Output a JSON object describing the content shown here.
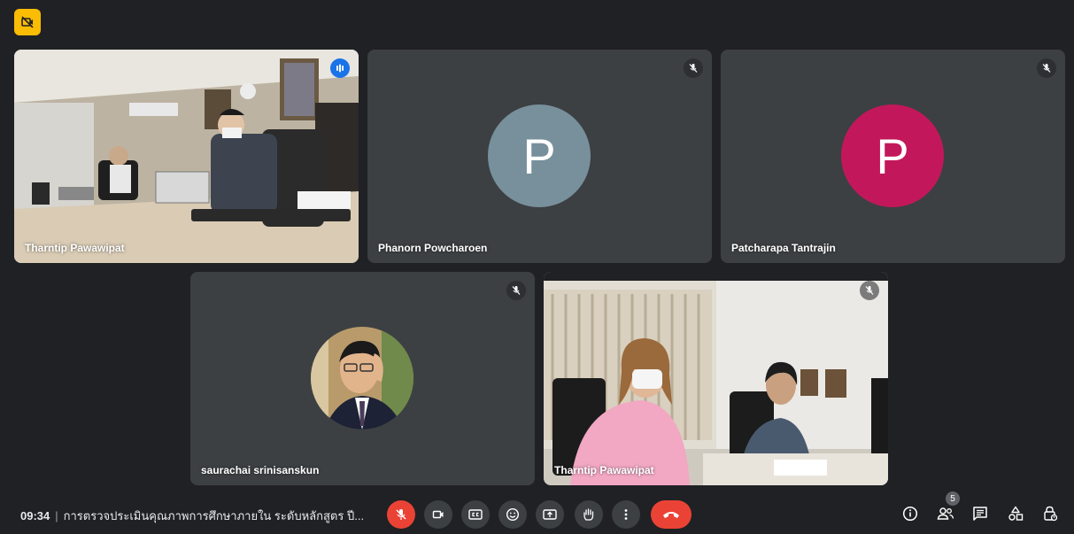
{
  "participants": [
    {
      "name": "Tharntip Pawawipat",
      "type": "video"
    },
    {
      "name": "Phanorn Powcharoen",
      "type": "avatar",
      "initial": "P",
      "color": "#78909c"
    },
    {
      "name": "Patcharapa Tantrajin",
      "type": "avatar",
      "initial": "P",
      "color": "#c2185b"
    },
    {
      "name": "saurachai srinisanskun",
      "type": "photo"
    },
    {
      "name": "Tharntip Pawawipat",
      "type": "video"
    }
  ],
  "meeting": {
    "time": "09:34",
    "separator": "|",
    "title": "การตรวจประเมินคุณภาพการศึกษาภายใน ระดับหลักสูตร ปี..."
  },
  "participant_count": "5",
  "colors": {
    "background": "#202124",
    "tile": "#3c4043",
    "active_outline": "#8ab4f8",
    "red": "#ea4335",
    "badge": "#fbbc04"
  }
}
